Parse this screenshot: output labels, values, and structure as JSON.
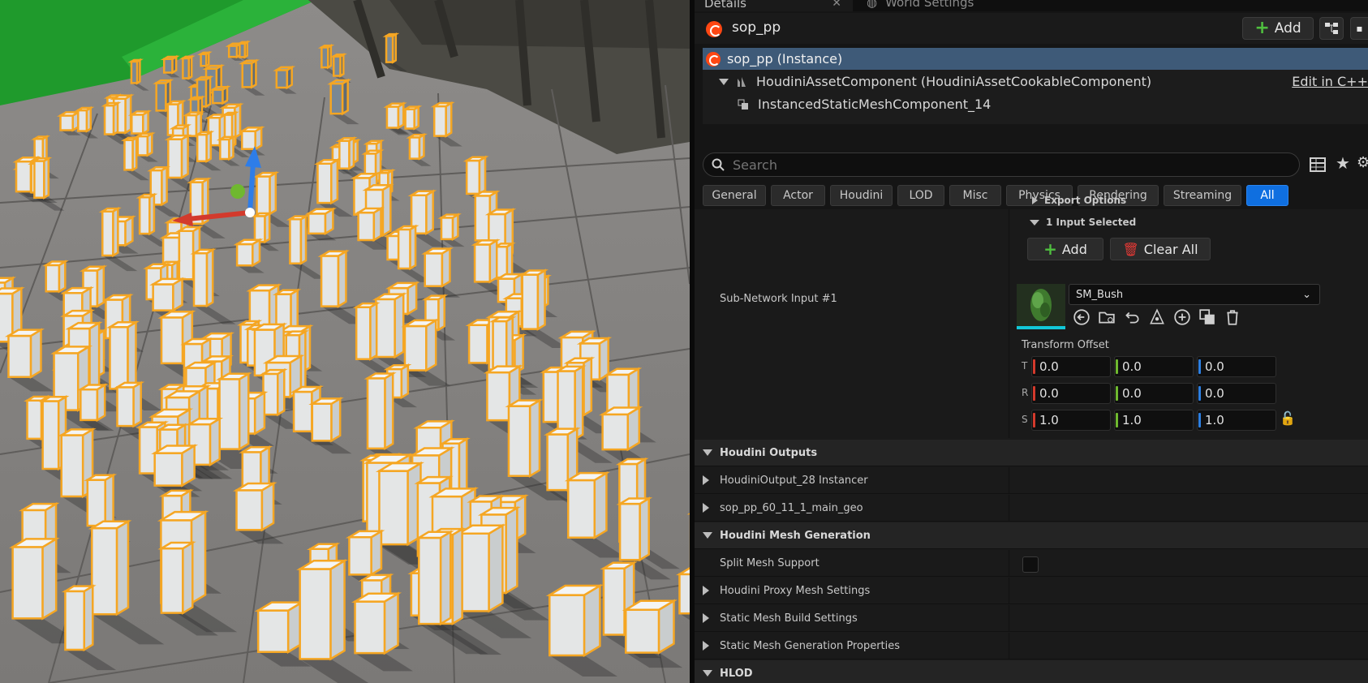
{
  "tabs": [
    {
      "label": "Details",
      "active": true
    },
    {
      "label": "World Settings",
      "active": false
    }
  ],
  "header": {
    "title": "sop_pp",
    "add_label": "Add"
  },
  "tree": {
    "instance": "sop_pp (Instance)",
    "component": "HoudiniAssetComponent (HoudiniAssetCookableComponent)",
    "child": "InstancedStaticMeshComponent_14",
    "edit_link": "Edit in C++"
  },
  "search": {
    "placeholder": "Search"
  },
  "filters": [
    "General",
    "Actor",
    "Houdini",
    "LOD",
    "Misc",
    "Physics",
    "Rendering",
    "Streaming",
    "All"
  ],
  "active_filter": "All",
  "input": {
    "export_options": "Export Options",
    "selected": "1 Input Selected",
    "add_label": "Add",
    "clear_label": "Clear All",
    "sub_label": "Sub-Network Input #1",
    "asset": "SM_Bush",
    "transform_label": "Transform Offset",
    "t": {
      "axis": "T",
      "x": "0.0",
      "y": "0.0",
      "z": "0.0"
    },
    "r": {
      "axis": "R",
      "x": "0.0",
      "y": "0.0",
      "z": "0.0"
    },
    "s": {
      "axis": "S",
      "x": "1.0",
      "y": "1.0",
      "z": "1.0"
    }
  },
  "sections": {
    "outputs": "Houdini Outputs",
    "output1": "HoudiniOutput_28 Instancer",
    "output2": "sop_pp_60_11_1_main_geo",
    "mesh_gen": "Houdini Mesh Generation",
    "split": "Split Mesh Support",
    "proxy": "Houdini Proxy Mesh Settings",
    "build": "Static Mesh Build Settings",
    "gen_props": "Static Mesh Generation Properties",
    "hlod": "HLOD"
  },
  "colors": {
    "accent": "#0f6fe0",
    "selection": "#3e5a78",
    "houdini": "#ff4713",
    "outline": "#f5a623"
  }
}
